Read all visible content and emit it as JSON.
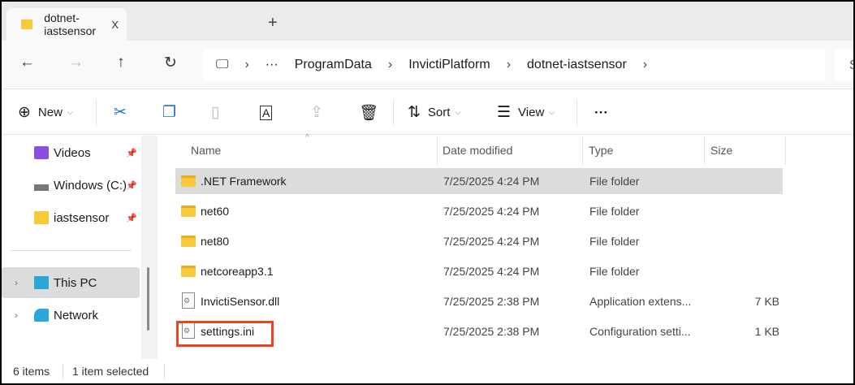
{
  "tab": {
    "title": "dotnet-iastsensor",
    "close": "X",
    "new_tab": "+"
  },
  "nav": {
    "back": "←",
    "forward": "→",
    "up": "↑",
    "refresh": "↻"
  },
  "breadcrumb": {
    "root_icon": "computer-icon",
    "overflow": "···",
    "items": [
      "ProgramData",
      "InvictiPlatform",
      "dotnet-iastsensor"
    ],
    "separator": "›"
  },
  "search": {
    "placeholder": "S"
  },
  "toolbar": {
    "new": "New",
    "sort": "Sort",
    "view": "View",
    "more": "···"
  },
  "sidebar": {
    "items": [
      {
        "label": "Videos",
        "icon": "videos-icon",
        "pinned": true
      },
      {
        "label": "Windows (C:)",
        "icon": "drive-icon",
        "pinned": true
      },
      {
        "label": "iastsensor",
        "icon": "folder-icon",
        "pinned": true
      },
      {
        "label": "This PC",
        "icon": "computer-icon",
        "selected": true
      },
      {
        "label": "Network",
        "icon": "network-icon"
      }
    ]
  },
  "columns": [
    "Name",
    "Date modified",
    "Type",
    "Size"
  ],
  "files": [
    {
      "name": ".NET Framework",
      "date": "7/25/2025 4:24 PM",
      "type": "File folder",
      "size": "",
      "kind": "folder",
      "selected": true
    },
    {
      "name": "net60",
      "date": "7/25/2025 4:24 PM",
      "type": "File folder",
      "size": "",
      "kind": "folder"
    },
    {
      "name": "net80",
      "date": "7/25/2025 4:24 PM",
      "type": "File folder",
      "size": "",
      "kind": "folder"
    },
    {
      "name": "netcoreapp3.1",
      "date": "7/25/2025 4:24 PM",
      "type": "File folder",
      "size": "",
      "kind": "folder"
    },
    {
      "name": "InvictiSensor.dll",
      "date": "7/25/2025 2:38 PM",
      "type": "Application extens...",
      "size": "7 KB",
      "kind": "file"
    },
    {
      "name": "settings.ini",
      "date": "7/25/2025 2:38 PM",
      "type": "Configuration setti...",
      "size": "1 KB",
      "kind": "file",
      "highlighted": true
    }
  ],
  "status": {
    "count": "6 items",
    "selection": "1 item selected"
  },
  "colors": {
    "highlight": "#f0401f",
    "folder": "#f8c93d",
    "selection": "#dcdcdc"
  }
}
